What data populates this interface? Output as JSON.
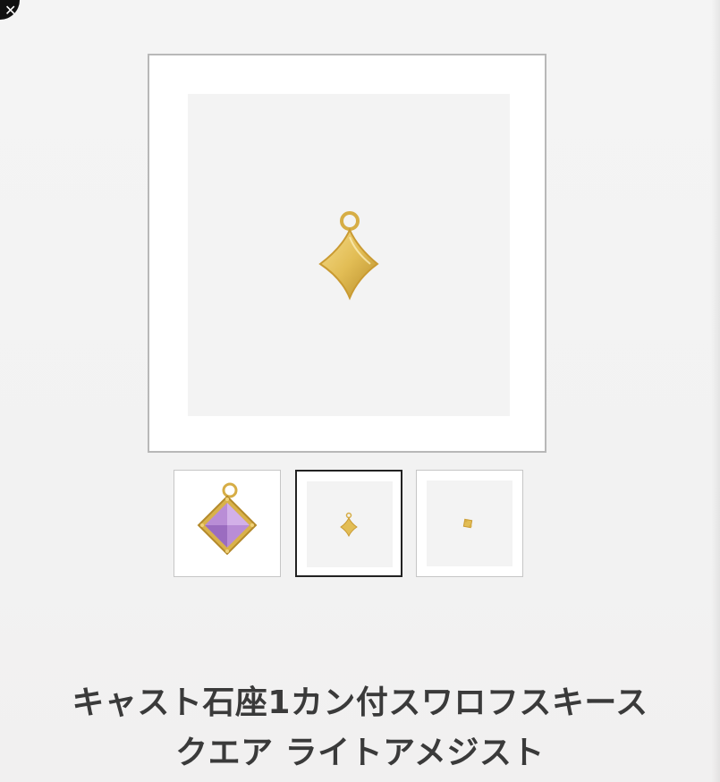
{
  "close_button": {
    "icon": "close-icon",
    "glyph": "✕"
  },
  "product": {
    "title_line1": "キャスト石座1カン付スワロフスキース",
    "title_line2": "クエア ライトアメジスト"
  },
  "gallery": {
    "main_image": {
      "icon": "gold-diamond-charm-image"
    },
    "thumbnails": [
      {
        "icon": "amethyst-square-charm-thumbnail",
        "selected": false
      },
      {
        "icon": "gold-diamond-charm-thumbnail",
        "selected": true
      },
      {
        "icon": "gold-charm-small-thumbnail",
        "selected": false
      }
    ]
  },
  "colors": {
    "gold": "#d9b24a",
    "gold_light": "#f1d27a",
    "amethyst": "#b98dd6",
    "frame_border": "#b8b8b8",
    "selected_border": "#222222"
  }
}
